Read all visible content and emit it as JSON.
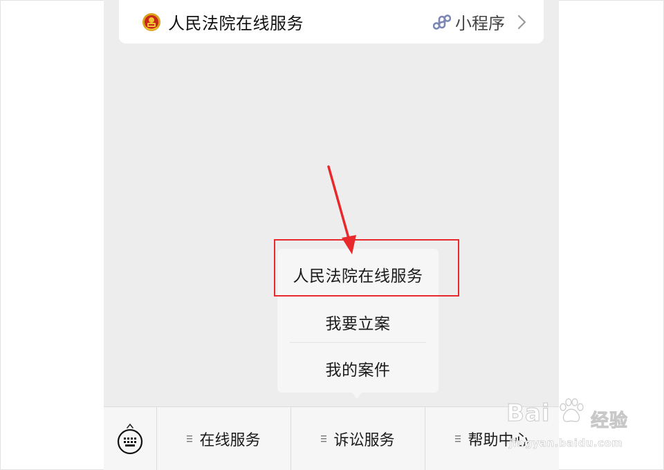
{
  "mini_program": {
    "logo": "court-emblem-icon",
    "title": "人民法院在线服务",
    "link_icon": "mini-program-icon",
    "tag": "小程序",
    "chevron": "chevron-right-icon"
  },
  "popup_menu": {
    "items": [
      "人民法院在线服务",
      "我要立案",
      "我的案件"
    ]
  },
  "annotation": {
    "highlight_color": "#e8282b",
    "arrow_color": "#e8282b"
  },
  "menu_bar": {
    "keyboard_icon": "keyboard-icon",
    "tabs": [
      {
        "label": "在线服务",
        "icon": "menu-lines-icon"
      },
      {
        "label": "诉讼服务",
        "icon": "menu-lines-icon"
      },
      {
        "label": "帮助中心",
        "icon": "menu-lines-icon"
      }
    ]
  },
  "watermark": {
    "brand": "Bai",
    "product": "经验",
    "url": "jingyan.baidu.com"
  },
  "colors": {
    "background": "#ededed",
    "card": "#ffffff",
    "menu_bg": "#f6f6f6",
    "link_icon": "#7b86b5"
  }
}
